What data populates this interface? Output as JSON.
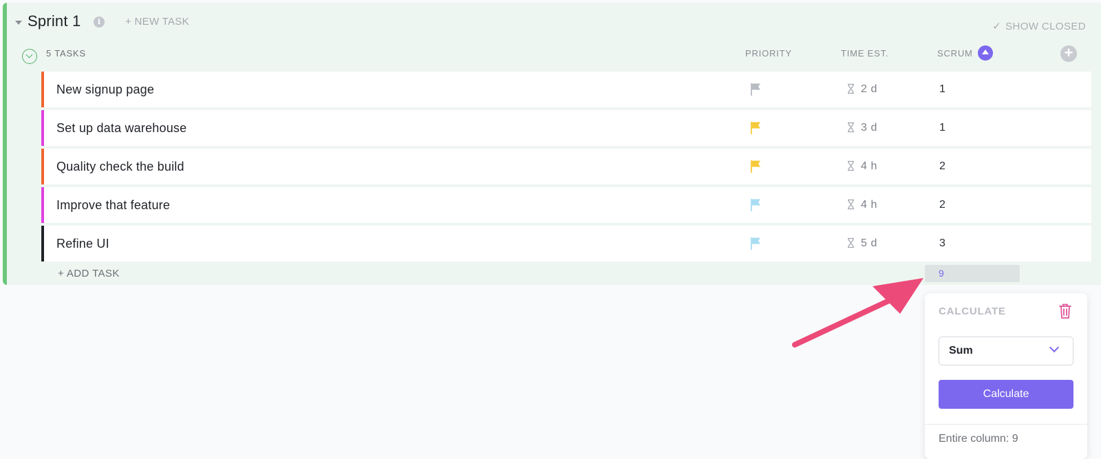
{
  "list": {
    "title": "Sprint 1",
    "info_icon": "info-icon",
    "new_task_label": "+ NEW TASK",
    "show_closed_check": "✓",
    "show_closed_label": "SHOW CLOSED",
    "task_count_label": "5 TASKS",
    "add_task_label": "+ ADD TASK",
    "accent_color": "#6bc77a"
  },
  "columns": {
    "priority": "PRIORITY",
    "time_est": "TIME EST.",
    "scrum": "SCRUM"
  },
  "tasks": [
    {
      "name": "New signup page",
      "status_color": "#f0642d",
      "priority": "none",
      "priority_color": "#b7bbc2",
      "time": "2 d",
      "scrum": "1"
    },
    {
      "name": "Set up data warehouse",
      "status_color": "#e040e0",
      "priority": "normal",
      "priority_color": "#f6c938",
      "time": "3 d",
      "scrum": "1"
    },
    {
      "name": "Quality check the build",
      "status_color": "#f0642d",
      "priority": "normal",
      "priority_color": "#f6c938",
      "time": "4 h",
      "scrum": "2"
    },
    {
      "name": "Improve that feature",
      "status_color": "#e040e0",
      "priority": "low",
      "priority_color": "#a8ddf3",
      "time": "4 h",
      "scrum": "2"
    },
    {
      "name": "Refine UI",
      "status_color": "#1f2228",
      "priority": "low",
      "priority_color": "#a8ddf3",
      "time": "5 d",
      "scrum": "3"
    }
  ],
  "scrum_total": "9",
  "calculate_popover": {
    "title": "CALCULATE",
    "selected_function": "Sum",
    "button_label": "Calculate",
    "entire_column_text": "Entire column: 9",
    "button_color": "#7b68ee",
    "trash_color": "#e0559a"
  },
  "annotation": {
    "arrow_color": "#ec4a78"
  }
}
